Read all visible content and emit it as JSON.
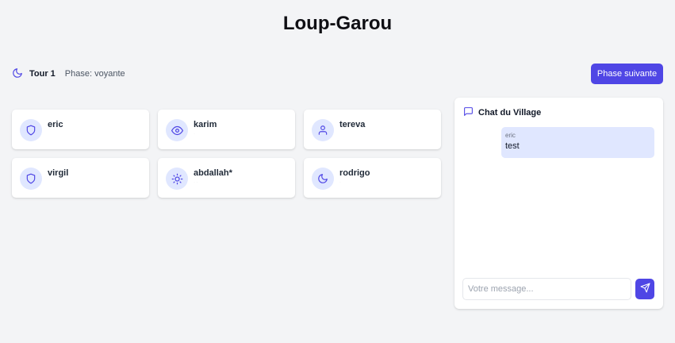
{
  "app": {
    "title": "Loup-Garou"
  },
  "status": {
    "turn_label": "Tour 1",
    "phase_label": "Phase: voyante",
    "icon": "moon-icon"
  },
  "actions": {
    "next_phase_label": "Phase suivante"
  },
  "players": [
    {
      "name": "eric",
      "icon": "shield-icon",
      "sub": ""
    },
    {
      "name": "karim",
      "icon": "eye-icon",
      "sub": "·"
    },
    {
      "name": "tereva",
      "icon": "user-icon",
      "sub": ""
    },
    {
      "name": "virgil",
      "icon": "shield-icon",
      "sub": ""
    },
    {
      "name": "abdallah*",
      "icon": "sun-icon",
      "sub": "· ·"
    },
    {
      "name": "rodrigo",
      "icon": "moon-icon",
      "sub": "·"
    }
  ],
  "chat": {
    "title": "Chat du Village",
    "messages": [
      {
        "author": "eric",
        "text": "test"
      }
    ],
    "input_placeholder": "Votre message...",
    "input_value": ""
  },
  "colors": {
    "accent": "#4f46e5",
    "accent_light": "#e0e7ff",
    "background": "#f3f4f6",
    "card": "#ffffff"
  }
}
